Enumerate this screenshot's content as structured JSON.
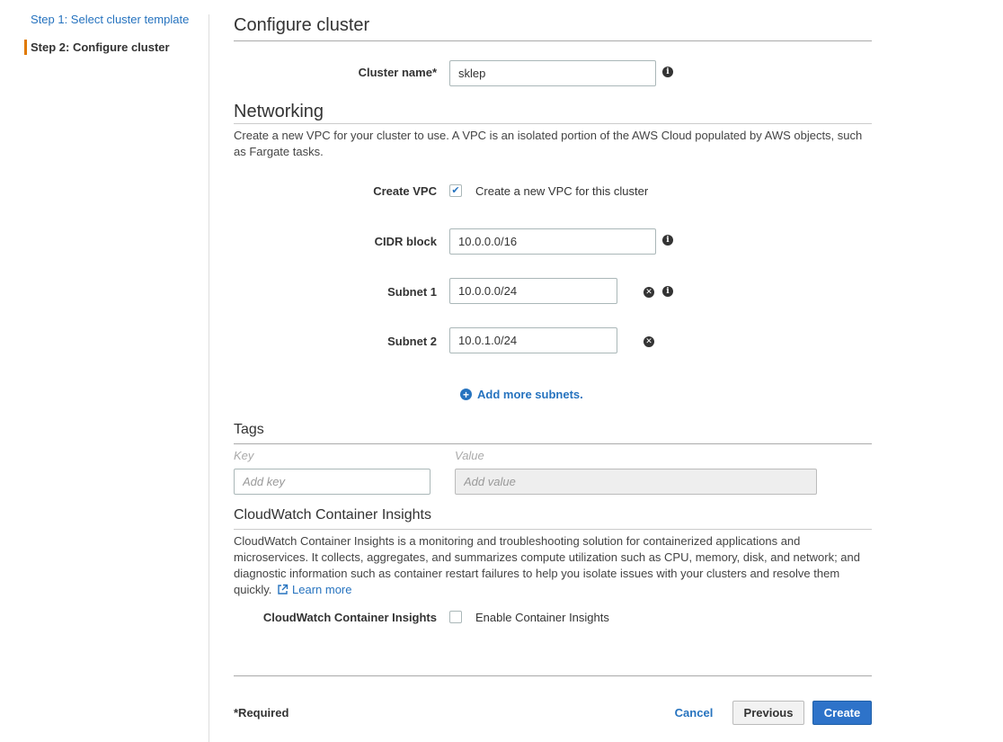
{
  "sidebar": {
    "step1": "Step 1: Select cluster template",
    "step2": "Step 2: Configure cluster"
  },
  "configure": {
    "title": "Configure cluster",
    "cluster_name_label": "Cluster name*",
    "cluster_name_value": "sklep"
  },
  "networking": {
    "title": "Networking",
    "description": "Create a new VPC for your cluster to use. A VPC is an isolated portion of the AWS Cloud populated by AWS objects, such as Fargate tasks.",
    "create_vpc_label": "Create VPC",
    "create_vpc_checkbox_label": "Create a new VPC for this cluster",
    "create_vpc_checked": true,
    "cidr_label": "CIDR block",
    "cidr_value": "10.0.0.0/16",
    "subnet1_label": "Subnet 1",
    "subnet1_value": "10.0.0.0/24",
    "subnet2_label": "Subnet 2",
    "subnet2_value": "10.0.1.0/24",
    "add_subnets": "Add more subnets."
  },
  "tags": {
    "title": "Tags",
    "key_header": "Key",
    "value_header": "Value",
    "key_placeholder": "Add key",
    "value_placeholder": "Add value"
  },
  "insights": {
    "title": "CloudWatch Container Insights",
    "description": "CloudWatch Container Insights is a monitoring and troubleshooting solution for containerized applications and microservices. It collects, aggregates, and summarizes compute utilization such as CPU, memory, disk, and network; and diagnostic information such as container restart failures to help you isolate issues with your clusters and resolve them quickly.",
    "learn_more": "Learn more",
    "label": "CloudWatch Container Insights",
    "checkbox_label": "Enable Container Insights",
    "checked": false
  },
  "footer": {
    "required": "*Required",
    "cancel": "Cancel",
    "previous": "Previous",
    "create": "Create"
  },
  "icons": {
    "info": "info-icon",
    "remove": "close-icon",
    "add": "plus-circle-icon",
    "external": "external-link-icon",
    "check": "checkmark-icon"
  },
  "colors": {
    "link": "#2673bf",
    "primary_button": "#2e73c9",
    "active_step": "#e07900"
  }
}
